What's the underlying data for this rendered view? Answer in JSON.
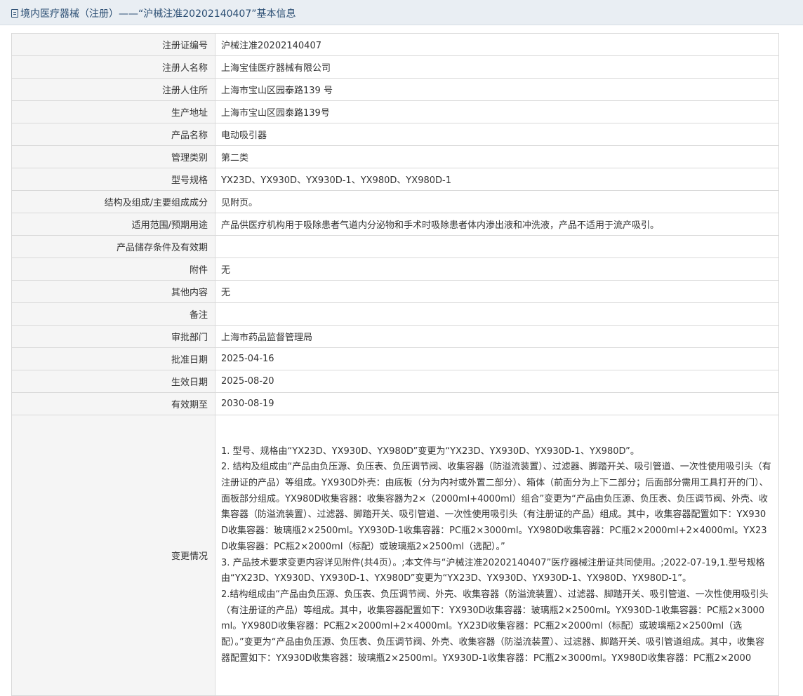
{
  "header": {
    "title": "境内医疗器械（注册）——“沪械注准20202140407”基本信息",
    "icon": "document-icon"
  },
  "rows": [
    {
      "label": "注册证编号",
      "value": "沪械注准20202140407"
    },
    {
      "label": "注册人名称",
      "value": "上海宝佳医疗器械有限公司"
    },
    {
      "label": "注册人住所",
      "value": "上海市宝山区园泰路139 号"
    },
    {
      "label": "生产地址",
      "value": "上海市宝山区园泰路139号"
    },
    {
      "label": "产品名称",
      "value": "电动吸引器"
    },
    {
      "label": "管理类别",
      "value": "第二类"
    },
    {
      "label": "型号规格",
      "value": "YX23D、YX930D、YX930D-1、YX980D、YX980D-1"
    },
    {
      "label": "结构及组成/主要组成成分",
      "value": "见附页。"
    },
    {
      "label": "适用范围/预期用途",
      "value": "产品供医疗机构用于吸除患者气道内分泌物和手术时吸除患者体内渗出液和冲洗液，产品不适用于流产吸引。"
    },
    {
      "label": "产品储存条件及有效期",
      "value": ""
    },
    {
      "label": "附件",
      "value": "无"
    },
    {
      "label": "其他内容",
      "value": "无"
    },
    {
      "label": "备注",
      "value": ""
    },
    {
      "label": "审批部门",
      "value": "上海市药品监督管理局"
    },
    {
      "label": "批准日期",
      "value": "2025-04-16"
    },
    {
      "label": "生效日期",
      "value": "2025-08-20"
    },
    {
      "label": "有效期至",
      "value": "2030-08-19"
    }
  ],
  "change": {
    "label": "变更情况",
    "lines": [
      "1. 型号、规格由“YX23D、YX930D、YX980D”变更为“YX23D、YX930D、YX930D-1、YX980D”。",
      "2. 结构及组成由“产品由负压源、负压表、负压调节阀、收集容器（防溢流装置）、过滤器、脚踏开关、吸引管道、一次性使用吸引头（有注册证的产品）等组成。YX930D外壳：由底板（分为内衬或外置二部分）、箱体（前面分为上下二部分；后面部分需用工具打开的门）、面板部分组成。YX980D收集容器：收集容器为2×（2000ml+4000ml）组合”变更为“产品由负压源、负压表、负压调节阀、外壳、收集容器（防溢流装置）、过滤器、脚踏开关、吸引管道、一次性使用吸引头（有注册证的产品）组成。其中，收集容器配置如下：YX930D收集容器：玻璃瓶2×2500ml。YX930D-1收集容器：PC瓶2×3000ml。YX980D收集容器：PC瓶2×2000ml+2×4000ml。YX23D收集容器：PC瓶2×2000ml（标配）或玻璃瓶2×2500ml（选配）。”",
      "3. 产品技术要求变更内容详见附件(共4页）。;本文件与“沪械注准20202140407”医疗器械注册证共同使用。;2022-07-19,1.型号规格由“YX23D、YX930D、YX930D-1、YX980D”变更为“YX23D、YX930D、YX930D-1、YX980D、YX980D-1”。",
      "2.结构组成由“产品由负压源、负压表、负压调节阀、外壳、收集容器（防溢流装置）、过滤器、脚踏开关、吸引管道、一次性使用吸引头（有注册证的产品）等组成。其中，收集容器配置如下：YX930D收集容器：玻璃瓶2×2500ml。YX930D-1收集容器：PC瓶2×3000ml。YX980D收集容器：PC瓶2×2000ml+2×4000ml。YX23D收集容器：PC瓶2×2000ml（标配）或玻璃瓶2×2500ml（选配）。”变更为“产品由负压源、负压表、负压调节阀、外壳、收集容器（防溢流装置）、过滤器、脚踏开关、吸引管道组成。其中，收集容器配置如下：YX930D收集容器：玻璃瓶2×2500ml。YX930D-1收集容器：PC瓶2×3000ml。YX980D收集容器：PC瓶2×2000"
    ]
  }
}
